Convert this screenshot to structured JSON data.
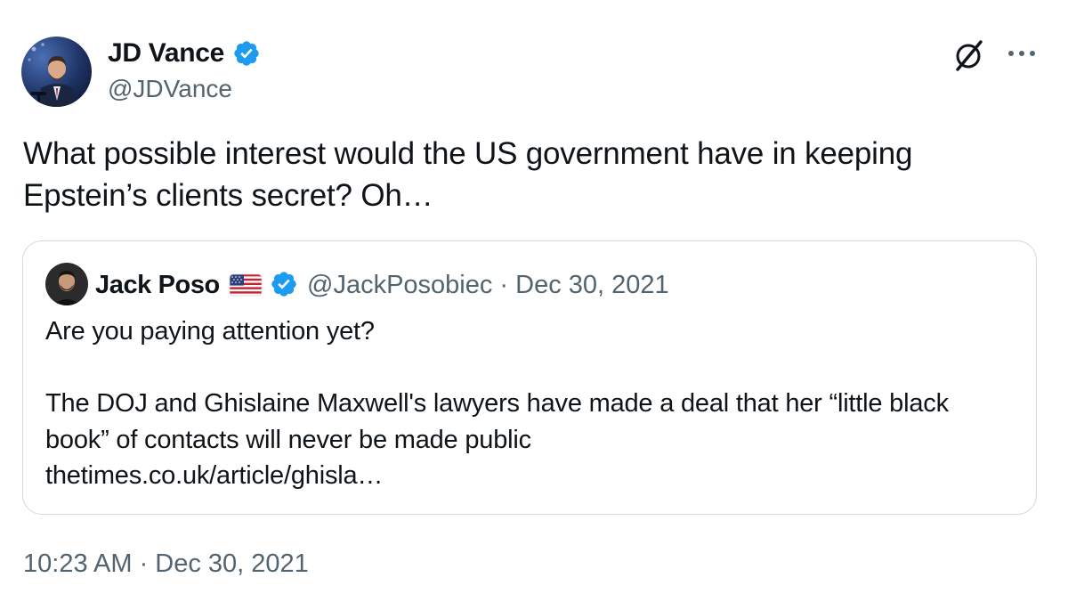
{
  "tweet": {
    "author": {
      "name": "JD Vance",
      "handle": "@JDVance",
      "verified": true,
      "avatar_icon": "avatar-photo-icon"
    },
    "text": "What possible interest would the US government have in keeping\nEpstein’s clients secret? Oh…",
    "timestamp": "10:23 AM · Dec 30, 2021",
    "header_icons": [
      "grok-icon",
      "more-options-icon"
    ]
  },
  "quote": {
    "author": {
      "name": "Jack Poso",
      "flag": "us-flag-icon",
      "verified": true,
      "handle": "@JackPosobiec",
      "date": "Dec 30, 2021"
    },
    "meta": "@JackPosobiec · Dec 30, 2021",
    "text": "Are you paying attention yet?\n\nThe DOJ and Ghislaine Maxwell's lawyers have made a deal that her “little black book” of contacts will never be made public",
    "link": "thetimes.co.uk/article/ghisla…"
  },
  "colors": {
    "text": "#0f1419",
    "secondary": "#536471",
    "verified_blue": "#1d9bf0",
    "border": "#cfd9de"
  }
}
